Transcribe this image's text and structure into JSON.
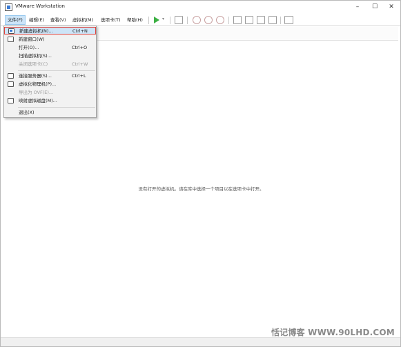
{
  "window": {
    "title": "VMware Workstation"
  },
  "menubar": {
    "file": "文件(F)",
    "edit": "编辑(E)",
    "view": "查看(V)",
    "vm": "虚拟机(M)",
    "tabs": "选项卡(T)",
    "help": "帮助(H)"
  },
  "file_menu": {
    "new_vm": {
      "label": "新建虚拟机(N)...",
      "shortcut": "Ctrl+N"
    },
    "new_window": {
      "label": "新建窗口(W)"
    },
    "open": {
      "label": "打开(O)...",
      "shortcut": "Ctrl+O"
    },
    "scan_vms": {
      "label": "扫描虚拟机(S)..."
    },
    "close_tab": {
      "label": "关闭选项卡(C)",
      "shortcut": "Ctrl+W"
    },
    "connect_server": {
      "label": "连接服务器(S)...",
      "shortcut": "Ctrl+L"
    },
    "virtualize_pc": {
      "label": "虚拟化物理机(P)..."
    },
    "export_ovf": {
      "label": "导出为 OVF(E)..."
    },
    "map_disk": {
      "label": "映射虚拟磁盘(M)..."
    },
    "exit": {
      "label": "退出(X)"
    }
  },
  "main": {
    "empty_message": "没有打开的虚拟机。请在库中选择一个项目以在选项卡中打开。"
  },
  "watermark": "恬记博客 WWW.90LHD.COM",
  "colors": {
    "highlight_border": "#e0413a",
    "highlight_bg": "#cde4f7",
    "play_green": "#3cb043"
  }
}
